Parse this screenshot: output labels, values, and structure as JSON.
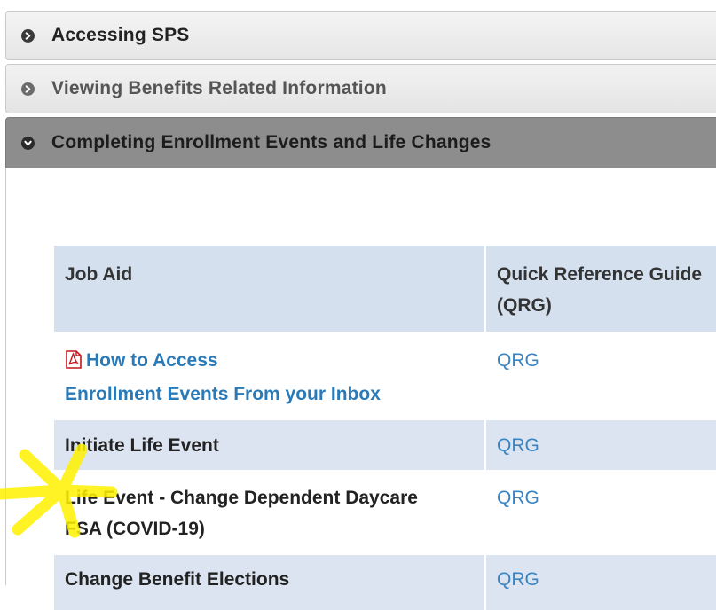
{
  "accordion": {
    "sections": [
      {
        "label": "Accessing SPS",
        "state": "collapsed"
      },
      {
        "label": "Viewing Benefits Related Information",
        "state": "collapsed"
      },
      {
        "label": "Completing Enrollment Events and Life Changes",
        "state": "expanded"
      }
    ]
  },
  "table": {
    "headers": [
      "Job Aid",
      "Quick Reference Guide (QRG)"
    ],
    "rows": [
      {
        "job_aid_line1": "How to Access",
        "job_aid_line2": "Enrollment Events From your Inbox",
        "qrg": "QRG",
        "icon": "pdf-icon"
      },
      {
        "job_aid": "Initiate Life Event",
        "qrg": "QRG"
      },
      {
        "job_aid_line1": "Life Event - Change Dependent Daycare",
        "job_aid_line2": "FSA (COVID-19)",
        "qrg": "QRG"
      },
      {
        "job_aid": "Change Benefit Elections",
        "qrg": "QRG"
      }
    ]
  },
  "colors": {
    "header_bg": "#d5e0ef",
    "row_alt_bg": "#dbe4f0",
    "link": "#2a7ab8",
    "active_header": "#8d8d8d",
    "highlight": "#fff200"
  }
}
